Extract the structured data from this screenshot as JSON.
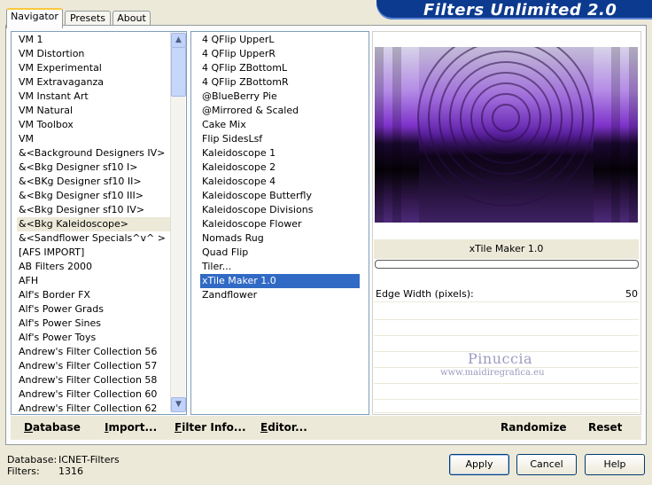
{
  "banner": {
    "title": "Filters Unlimited 2.0"
  },
  "tabs": [
    {
      "label": "Navigator",
      "active": true
    },
    {
      "label": "Presets",
      "active": false
    },
    {
      "label": "About",
      "active": false
    }
  ],
  "categories": [
    "VM 1",
    "VM Distortion",
    "VM Experimental",
    "VM Extravaganza",
    "VM Instant Art",
    "VM Natural",
    "VM Toolbox",
    "VM",
    "&<Background Designers IV>",
    "&<Bkg Designer sf10 I>",
    "&<BKg Designer sf10 II>",
    "&<Bkg Designer sf10 III>",
    "&<Bkg Designer sf10 IV>",
    "&<Bkg Kaleidoscope>",
    "&<Sandflower Specials^v^ >",
    "[AFS IMPORT]",
    "AB Filters 2000",
    "AFH",
    "Alf's Border FX",
    "Alf's Power Grads",
    "Alf's Power Sines",
    "Alf's Power Toys",
    "Andrew's Filter Collection 56",
    "Andrew's Filter Collection 57",
    "Andrew's Filter Collection 58",
    "Andrew's Filter Collection 60",
    "Andrew's Filter Collection 62"
  ],
  "categories_selected": "&<Bkg Kaleidoscope>",
  "filters": [
    "4 QFlip UpperL",
    "4 QFlip UpperR",
    "4 QFlip ZBottomL",
    "4 QFlip ZBottomR",
    "@BlueBerry Pie",
    "@Mirrored & Scaled",
    "Cake Mix",
    "Flip SidesLsf",
    "Kaleidoscope 1",
    "Kaleidoscope 2",
    "Kaleidoscope 4",
    "Kaleidoscope Butterfly",
    "Kaleidoscope Divisions",
    "Kaleidoscope Flower",
    "Nomads Rug",
    "Quad Flip",
    "Tiler...",
    "xTile Maker 1.0",
    "Zandflower"
  ],
  "filters_selected": "xTile Maker 1.0",
  "filter_name": "xTile Maker 1.0",
  "params": {
    "edge_label": "Edge Width (pixels):",
    "edge_value": "50"
  },
  "watermark": {
    "line1": "Pinuccia",
    "line2": "www.maidiregrafica.eu"
  },
  "toolbar": {
    "database": "Database",
    "import": "Import...",
    "filter_info": "Filter Info...",
    "editor": "Editor...",
    "randomize": "Randomize",
    "reset": "Reset"
  },
  "status": {
    "database_label": "Database:",
    "database_value": "ICNET-Filters",
    "filters_label": "Filters:",
    "filters_value": "1316"
  },
  "buttons": {
    "apply": "Apply",
    "cancel": "Cancel",
    "help": "Help"
  },
  "colors": {
    "banner": "#0c3a8f",
    "selection": "#316ac5",
    "preview_purple": "#8a3fd0"
  }
}
